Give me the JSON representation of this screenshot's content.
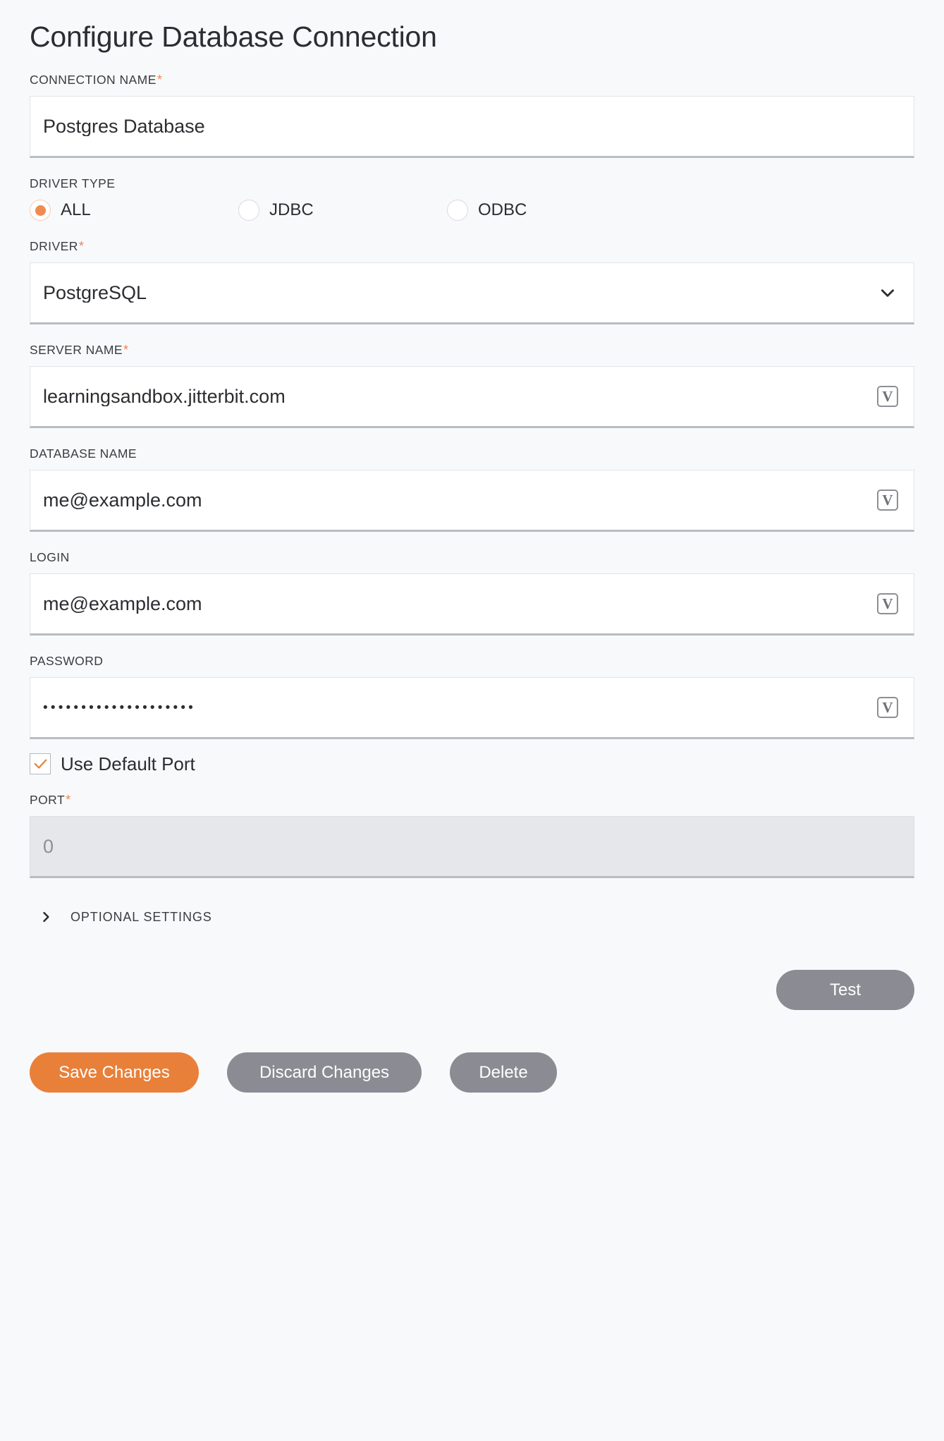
{
  "header": {
    "title": "Configure Database Connection"
  },
  "fields": {
    "connection_name": {
      "label": "CONNECTION NAME",
      "required": true,
      "value": "Postgres Database"
    },
    "driver_type": {
      "label": "DRIVER TYPE",
      "required": false,
      "selected": "ALL",
      "options": [
        "ALL",
        "JDBC",
        "ODBC"
      ]
    },
    "driver": {
      "label": "DRIVER",
      "required": true,
      "value": "PostgreSQL",
      "icon": "chevron-down-icon"
    },
    "server_name": {
      "label": "SERVER NAME",
      "required": true,
      "value": "learningsandbox.jitterbit.com",
      "icon": "variable-icon",
      "icon_glyph": "V"
    },
    "database_name": {
      "label": "DATABASE NAME",
      "required": false,
      "value": "me@example.com",
      "icon": "variable-icon",
      "icon_glyph": "V"
    },
    "login": {
      "label": "LOGIN",
      "required": false,
      "value": "me@example.com",
      "icon": "variable-icon",
      "icon_glyph": "V"
    },
    "password": {
      "label": "PASSWORD",
      "required": false,
      "value": "••••••••••••••••••••",
      "icon": "variable-icon",
      "icon_glyph": "V"
    },
    "use_default_port": {
      "label": "Use Default Port",
      "checked": true
    },
    "port": {
      "label": "PORT",
      "required": true,
      "value": "0",
      "disabled": true
    }
  },
  "optional_settings": {
    "label": "OPTIONAL SETTINGS",
    "expanded": false,
    "icon": "chevron-right-icon"
  },
  "actions": {
    "test": "Test",
    "save": "Save Changes",
    "discard": "Discard Changes",
    "delete": "Delete"
  },
  "colors": {
    "accent": "#e8803a",
    "required_star": "#ef8354",
    "radio_selected": "#f08b52",
    "checkbox_check": "#e8803a",
    "neutral_button": "#8b8b93",
    "page_background": "#f8f9fb",
    "input_background": "#ffffff",
    "input_disabled_background": "#e6e7ea"
  }
}
